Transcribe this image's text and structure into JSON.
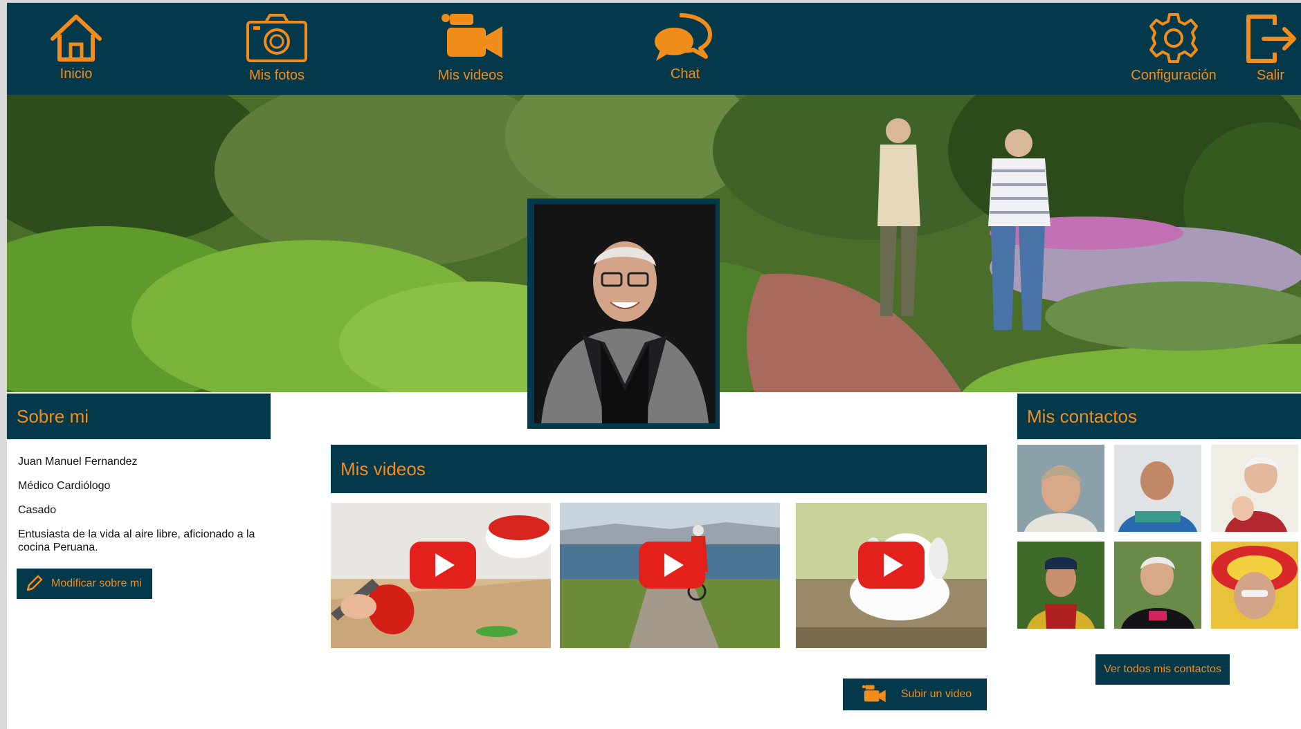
{
  "nav": {
    "items": [
      {
        "label": "Inicio",
        "icon": "home-icon"
      },
      {
        "label": "Mis fotos",
        "icon": "camera-icon"
      },
      {
        "label": "Mis videos",
        "icon": "video-camera-icon"
      },
      {
        "label": "Chat",
        "icon": "chat-bubbles-icon"
      },
      {
        "label": "Configuración",
        "icon": "gear-icon"
      },
      {
        "label": "Salir",
        "icon": "logout-icon"
      }
    ]
  },
  "about": {
    "title": "Sobre mi",
    "name": "Juan Manuel Fernandez",
    "profession": "Médico Cardiólogo",
    "status": "Casado",
    "bio": "Entusiasta de la vida al aire libre, aficionado a la cocina Peruana.",
    "edit_button": "Modificar sobre mi"
  },
  "videos": {
    "title": "Mis videos",
    "items": [
      {
        "subject": "cooking-peppers"
      },
      {
        "subject": "cycling-by-lake"
      },
      {
        "subject": "white-puppy"
      }
    ],
    "upload_button": "Subir un video"
  },
  "contacts": {
    "title": "Mis contactos",
    "view_all_button": "Ver todos mis contactos"
  },
  "colors": {
    "navy": "#04394c",
    "orange": "#f28c1a",
    "play_red": "#e4201c"
  }
}
